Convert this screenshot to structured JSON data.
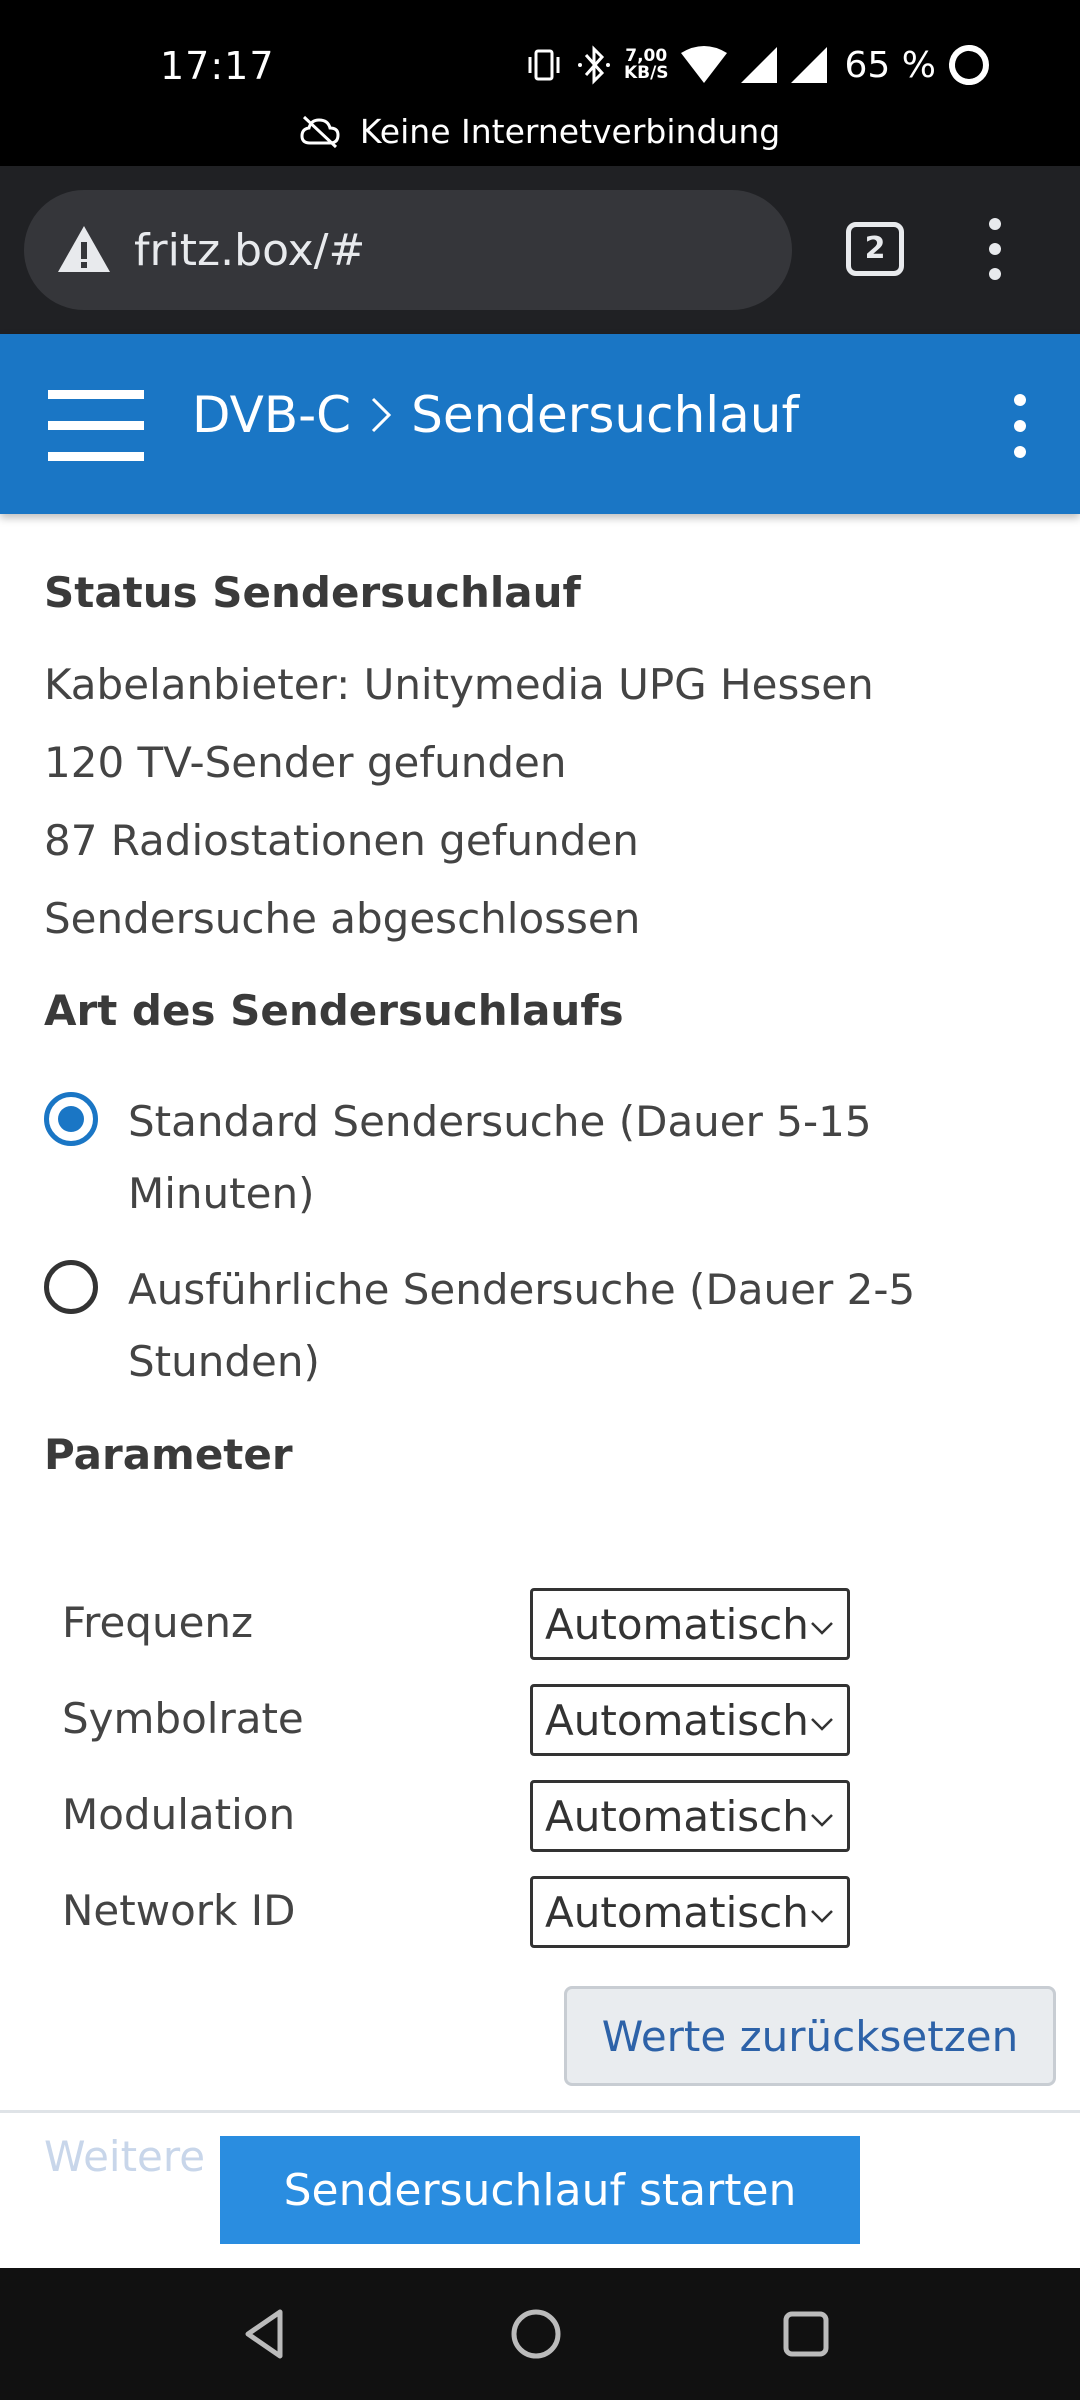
{
  "status_bar": {
    "time": "17:17",
    "speed_value": "7,00",
    "speed_unit": "KB/S",
    "battery": "65 %",
    "notice": "Keine Internetverbindung",
    "icons": [
      "vibrate-icon",
      "bluetooth-icon",
      "wifi-icon",
      "signal-icon",
      "signal-icon",
      "battery-ring-icon",
      "cloud-off-icon"
    ]
  },
  "browser": {
    "url": "fritz.box/#",
    "tab_count": "2",
    "icons": [
      "warning-icon",
      "tabs-icon",
      "more-vertical-icon"
    ]
  },
  "header": {
    "section": "DVB-C",
    "separator": ">",
    "page": "Sendersuchlauf",
    "icons": [
      "hamburger-icon",
      "more-vertical-icon"
    ],
    "color": "#1a76c5"
  },
  "status": {
    "title": "Status Sendersuchlauf",
    "provider": "Kabelanbieter: Unitymedia UPG Hessen",
    "tv_found": "120 TV-Sender gefunden",
    "radio_found": "87 Radiostationen gefunden",
    "state": "Sendersuche abgeschlossen"
  },
  "scan_type": {
    "title": "Art des Sendersuchlaufs",
    "options": [
      {
        "label": "Standard Sendersuche (Dauer 5-15 Minuten)",
        "checked": true
      },
      {
        "label": "Ausführliche Sendersuche (Dauer 2-5 Stunden)",
        "checked": false
      }
    ]
  },
  "parameters": {
    "title": "Parameter",
    "rows": [
      {
        "label": "Frequenz",
        "value": "Automatisch"
      },
      {
        "label": "Symbolrate",
        "value": "Automatisch"
      },
      {
        "label": "Modulation",
        "value": "Automatisch"
      },
      {
        "label": "Network ID",
        "value": "Automatisch"
      }
    ],
    "reset_label": "Werte zurücksetzen"
  },
  "footer": {
    "faded_text": "Weitere C",
    "start_label": "Sendersuchlauf starten",
    "start_color": "#2a8de0"
  },
  "navbar": {
    "icons": [
      "back-icon",
      "home-icon",
      "recents-icon"
    ]
  }
}
